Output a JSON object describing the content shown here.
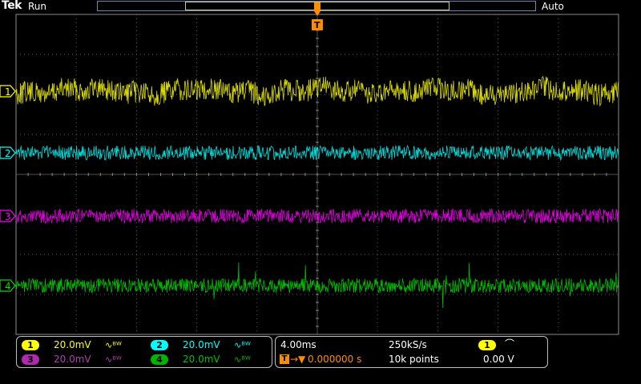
{
  "header": {
    "brand": "Tek",
    "run_state": "Run",
    "trigger_mode": "Auto"
  },
  "trigger_marker": {
    "label": "T"
  },
  "channels": [
    {
      "id": "1",
      "color": "#ffff00",
      "scale": "20.0mV",
      "bw_limit": "∿ᴮᵂ"
    },
    {
      "id": "2",
      "color": "#00ffff",
      "scale": "20.0mV",
      "bw_limit": "∿ᴮᵂ"
    },
    {
      "id": "3",
      "color": "#ff00ff",
      "scale": "20.0mV",
      "bw_limit": "∿ᴮᵂ"
    },
    {
      "id": "4",
      "color": "#00dd00",
      "scale": "20.0mV",
      "bw_limit": "∿ᴮᵂ"
    }
  ],
  "timebase": {
    "horizontal_scale": "4.00ms",
    "sample_rate": "250kS/s",
    "trigger_delay": "0.000000 s",
    "record_length": "10k points"
  },
  "trigger": {
    "source": "1",
    "slope_icon": "rising-edge-icon",
    "slope_glyph": "⌒",
    "level": "0.00 V"
  },
  "colors": {
    "grid": "#5a5a5a",
    "trigger_orange": "#ff8c00",
    "frame": "#8c8c8c"
  }
}
